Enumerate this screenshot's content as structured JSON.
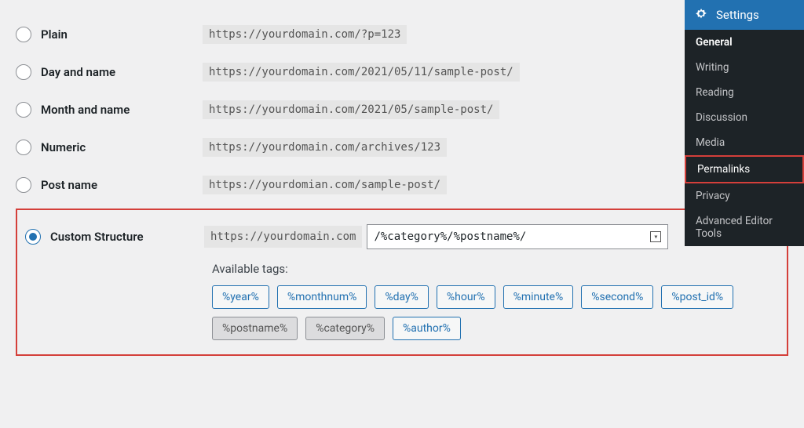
{
  "options": {
    "plain": {
      "label": "Plain",
      "url": "https://yourdomain.com/?p=123"
    },
    "dayname": {
      "label": "Day and name",
      "url": "https://yourdomain.com/2021/05/11/sample-post/"
    },
    "monthname": {
      "label": "Month and name",
      "url": "https://yourdomain.com/2021/05/sample-post/"
    },
    "numeric": {
      "label": "Numeric",
      "url": "https://yourdomain.com/archives/123"
    },
    "postname": {
      "label": "Post name",
      "url": "https://yourdomian.com/sample-post/"
    },
    "custom": {
      "label": "Custom Structure",
      "prefix": "https://yourdomain.com",
      "value": "/%category%/%postname%/"
    }
  },
  "tags": {
    "heading": "Available tags:",
    "list": {
      "year": "%year%",
      "monthnum": "%monthnum%",
      "day": "%day%",
      "hour": "%hour%",
      "minute": "%minute%",
      "second": "%second%",
      "post_id": "%post_id%",
      "postname": "%postname%",
      "category": "%category%",
      "author": "%author%"
    }
  },
  "sidebar": {
    "header": "Settings",
    "items": {
      "general": "General",
      "writing": "Writing",
      "reading": "Reading",
      "discussion": "Discussion",
      "media": "Media",
      "permalinks": "Permalinks",
      "privacy": "Privacy",
      "aet": "Advanced Editor Tools"
    }
  }
}
